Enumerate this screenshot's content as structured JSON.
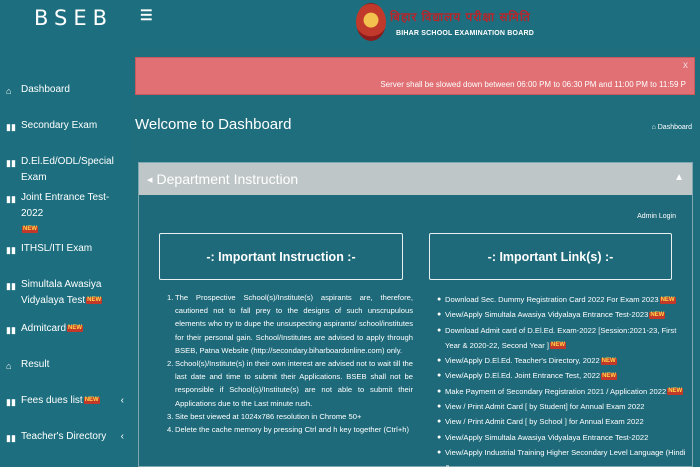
{
  "brand": "BSEB",
  "header": {
    "menu_icon": "hamburger-icon",
    "logo_hindi": "बिहार विद्यालय परीक्षा समिति",
    "logo_english": "BIHAR SCHOOL EXAMINATION BOARD"
  },
  "badge_new": "NEW",
  "sidebar": {
    "items": [
      {
        "label": "Dashboard",
        "icon": "home-icon"
      },
      {
        "label": "Secondary Exam",
        "icon": "bar-chart-icon"
      },
      {
        "label": "D.El.Ed/ODL/Special Exam",
        "icon": "bar-chart-icon"
      },
      {
        "label": "Joint Entrance Test-2022",
        "icon": "bar-chart-icon"
      },
      {
        "label": "ITHSL/ITI Exam",
        "icon": "bar-chart-icon"
      },
      {
        "label": "Simultala Awasiya Vidyalaya Test",
        "icon": "bar-chart-icon"
      },
      {
        "label": "Admitcard",
        "icon": "bar-chart-icon"
      },
      {
        "label": "Result",
        "icon": "home-icon"
      },
      {
        "label": "Fees dues list",
        "icon": "bar-chart-icon"
      },
      {
        "label": "Teacher's Directory",
        "icon": "bar-chart-icon"
      }
    ]
  },
  "alert": {
    "text": "Server shall be slowed down between 06:00 PM to 06:30 PM and 11:00 PM to 11:59 P",
    "close": "x"
  },
  "page": {
    "title": "Welcome to Dashboard",
    "breadcrumb": "Dashboard"
  },
  "panel": {
    "title": "Department Instruction",
    "admin_login": "Admin Login",
    "instruction_heading": "-: Important Instruction :-",
    "links_heading": "-: Important Link(s) :-",
    "instructions": [
      {
        "num": "1.",
        "text": "The Prospective School(s)/Institute(s) aspirants are, therefore, cautioned not to fall prey to the designs of such unscrupulous elements who try to dupe the unsuspecting aspirants/ school/institutes for their personal gain. School/Institutes are advised to apply through BSEB, Patna Website (http://secondary.biharboardonline.com) only."
      },
      {
        "num": "2.",
        "text": "School(s)/Institute(s) in their own interest are advised not to wait till the last date and time to submit their Applications. BSEB shall not be responsible if School(s)/Institute(s) are not able to submit their Applications due to the Last minute rush."
      },
      {
        "num": "3.",
        "text": "Site best viewed at 1024x786 resolution in Chrome 50+"
      },
      {
        "num": "4.",
        "text": "Delete the cache memory by pressing Ctrl and h key together (Ctrl+h)"
      }
    ],
    "links": [
      "Download Sec. Dummy Registration Card 2022 For Exam 2023",
      "View/Apply Simultala Awasiya Vidyalaya Entrance Test-2023",
      "Download Admit card of D.El.Ed. Exam-2022 [Session:2021-23, First Year & 2020-22, Second Year ]",
      "View/Apply D.El.Ed. Teacher's Directory, 2022",
      "View/Apply D.El.Ed. Joint Entrance Test, 2022",
      "Make Payment of Secondary Registration 2021 / Application 2022",
      "View / Print Admit Card [ by Student] for Annual Exam 2022",
      "View / Print Admit Card [ by School ] for Annual Exam 2022",
      "View/Apply Simultala Awasiya Vidyalaya Entrance Test-2022",
      "View/Apply Industrial Training Higher Secondary Level Language (Hindi &"
    ]
  },
  "colors": {
    "background": "#1f6e7e",
    "alert": "#e07074",
    "panel_header": "#bfc6c8",
    "badge": "#c0392b"
  }
}
